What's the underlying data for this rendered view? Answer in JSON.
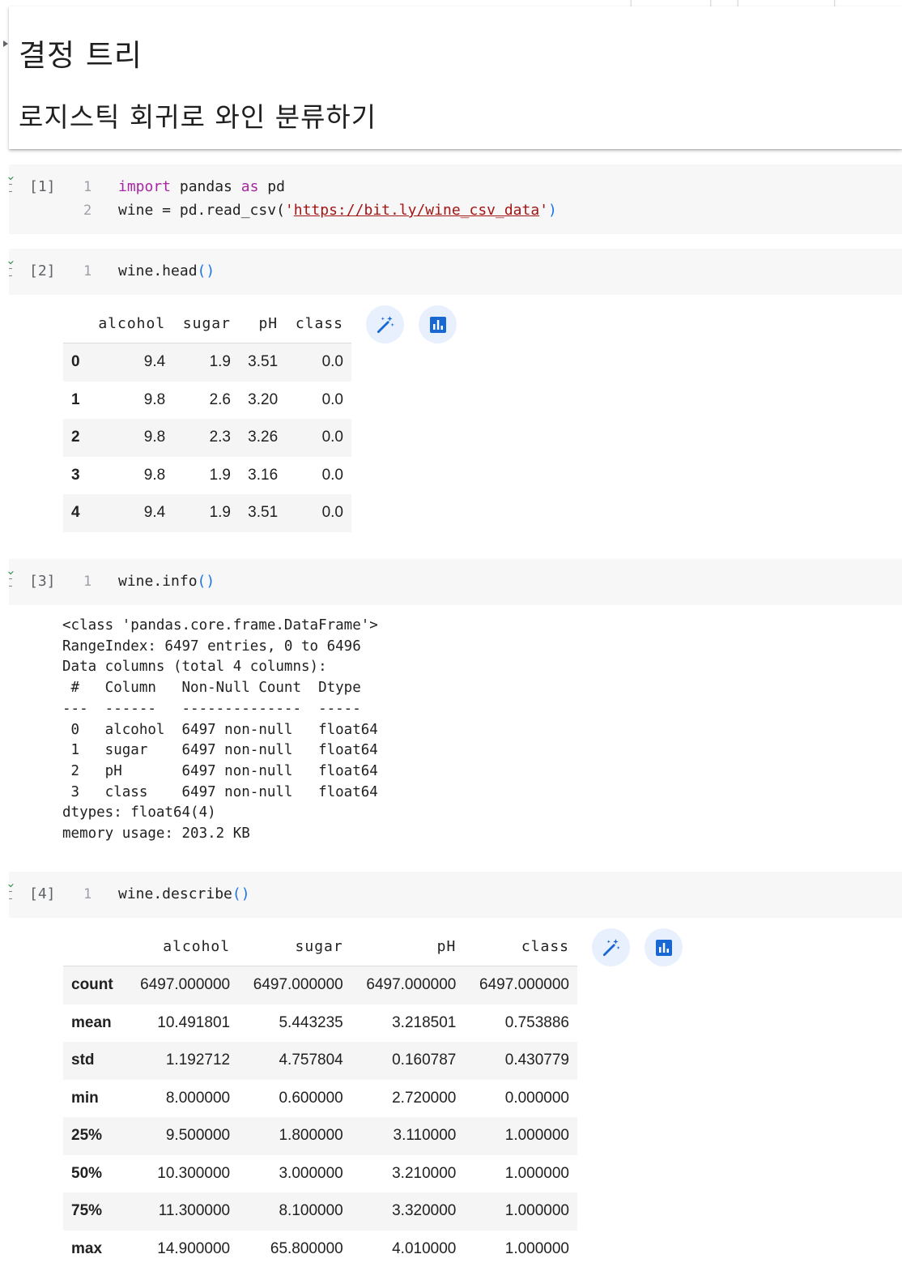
{
  "markdown": {
    "title": "결정 트리",
    "subtitle": "로지스틱 회귀로 와인 분류하기"
  },
  "cells": {
    "c1": {
      "exec": "[1]",
      "lines": [
        {
          "no": "1",
          "kw": "import",
          "a": " pandas ",
          "kw2": "as",
          "b": " pd"
        },
        {
          "no": "2",
          "pre": "wine = pd.read_csv(",
          "q1": "'",
          "url": "https://bit.ly/wine_csv_data",
          "q2": "'",
          "post": ")"
        }
      ]
    },
    "c2": {
      "exec": "[2]",
      "no": "1",
      "code": "wine.head",
      "paren": "()"
    },
    "c3": {
      "exec": "[3]",
      "no": "1",
      "code": "wine.info",
      "paren": "()"
    },
    "c4": {
      "exec": "[4]",
      "no": "1",
      "code": "wine.describe",
      "paren": "()"
    }
  },
  "head_table": {
    "columns": [
      "alcohol",
      "sugar",
      "pH",
      "class"
    ],
    "rows": [
      {
        "index": "0",
        "values": [
          "9.4",
          "1.9",
          "3.51",
          "0.0"
        ]
      },
      {
        "index": "1",
        "values": [
          "9.8",
          "2.6",
          "3.20",
          "0.0"
        ]
      },
      {
        "index": "2",
        "values": [
          "9.8",
          "2.3",
          "3.26",
          "0.0"
        ]
      },
      {
        "index": "3",
        "values": [
          "9.8",
          "1.9",
          "3.16",
          "0.0"
        ]
      },
      {
        "index": "4",
        "values": [
          "9.4",
          "1.9",
          "3.51",
          "0.0"
        ]
      }
    ]
  },
  "info_output": "<class 'pandas.core.frame.DataFrame'>\nRangeIndex: 6497 entries, 0 to 6496\nData columns (total 4 columns):\n #   Column   Non-Null Count  Dtype  \n---  ------   --------------  -----  \n 0   alcohol  6497 non-null   float64\n 1   sugar    6497 non-null   float64\n 2   pH       6497 non-null   float64\n 3   class    6497 non-null   float64\ndtypes: float64(4)\nmemory usage: 203.2 KB",
  "describe_table": {
    "columns": [
      "alcohol",
      "sugar",
      "pH",
      "class"
    ],
    "rows": [
      {
        "index": "count",
        "values": [
          "6497.000000",
          "6497.000000",
          "6497.000000",
          "6497.000000"
        ]
      },
      {
        "index": "mean",
        "values": [
          "10.491801",
          "5.443235",
          "3.218501",
          "0.753886"
        ]
      },
      {
        "index": "std",
        "values": [
          "1.192712",
          "4.757804",
          "0.160787",
          "0.430779"
        ]
      },
      {
        "index": "min",
        "values": [
          "8.000000",
          "0.600000",
          "2.720000",
          "0.000000"
        ]
      },
      {
        "index": "25%",
        "values": [
          "9.500000",
          "1.800000",
          "3.110000",
          "1.000000"
        ]
      },
      {
        "index": "50%",
        "values": [
          "10.300000",
          "3.000000",
          "3.210000",
          "1.000000"
        ]
      },
      {
        "index": "75%",
        "values": [
          "11.300000",
          "8.100000",
          "3.320000",
          "1.000000"
        ]
      },
      {
        "index": "max",
        "values": [
          "14.900000",
          "65.800000",
          "4.010000",
          "1.000000"
        ]
      }
    ]
  },
  "icons": {
    "magic": "magic-wand-icon",
    "chart": "bar-chart-icon",
    "accent": "#1967d2",
    "icon_bg": "#e8f0fe"
  }
}
